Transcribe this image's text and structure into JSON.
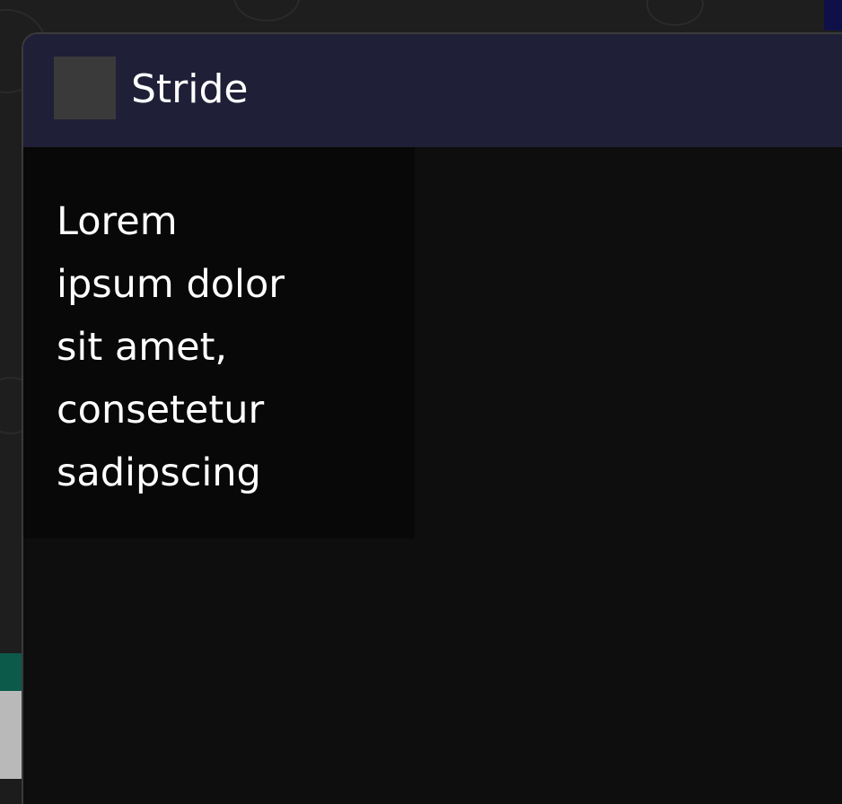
{
  "window": {
    "title": "Stride",
    "icon": "app-icon-placeholder"
  },
  "content": {
    "text": "Lorem ipsum dolor sit amet, consetetur sadipscing"
  },
  "colors": {
    "titlebar": "#1f1f38",
    "window_background": "#0e0e0e",
    "text_panel": "#080808",
    "text": "#ffffff"
  }
}
